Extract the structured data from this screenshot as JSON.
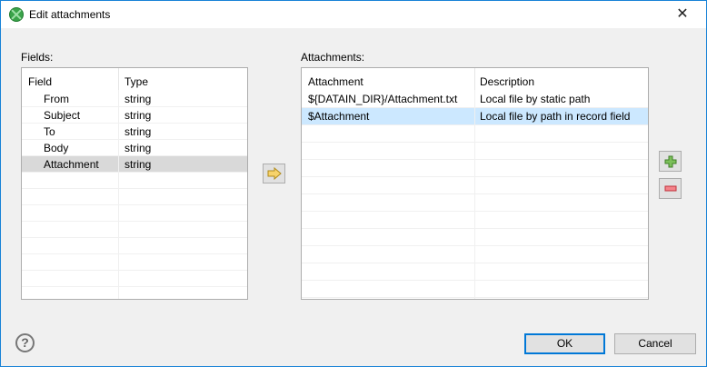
{
  "window": {
    "title": "Edit attachments",
    "close_icon": "close-icon"
  },
  "fields": {
    "label": "Fields:",
    "columns": [
      "Field",
      "Type"
    ],
    "rows": [
      {
        "field": "From",
        "type": "string"
      },
      {
        "field": "Subject",
        "type": "string"
      },
      {
        "field": "To",
        "type": "string"
      },
      {
        "field": "Body",
        "type": "string"
      },
      {
        "field": "Attachment",
        "type": "string",
        "selected": true
      }
    ]
  },
  "attachments": {
    "label": "Attachments:",
    "columns": [
      "Attachment",
      "Description"
    ],
    "rows": [
      {
        "attachment": "${DATAIN_DIR}/Attachment.txt",
        "description": "Local file by static path"
      },
      {
        "attachment": "$Attachment",
        "description": "Local file by path in record field",
        "selected": true
      }
    ]
  },
  "buttons": {
    "ok": "OK",
    "cancel": "Cancel",
    "help": "?"
  },
  "colors": {
    "selection": "#cce8ff",
    "accent": "#0078d7"
  }
}
